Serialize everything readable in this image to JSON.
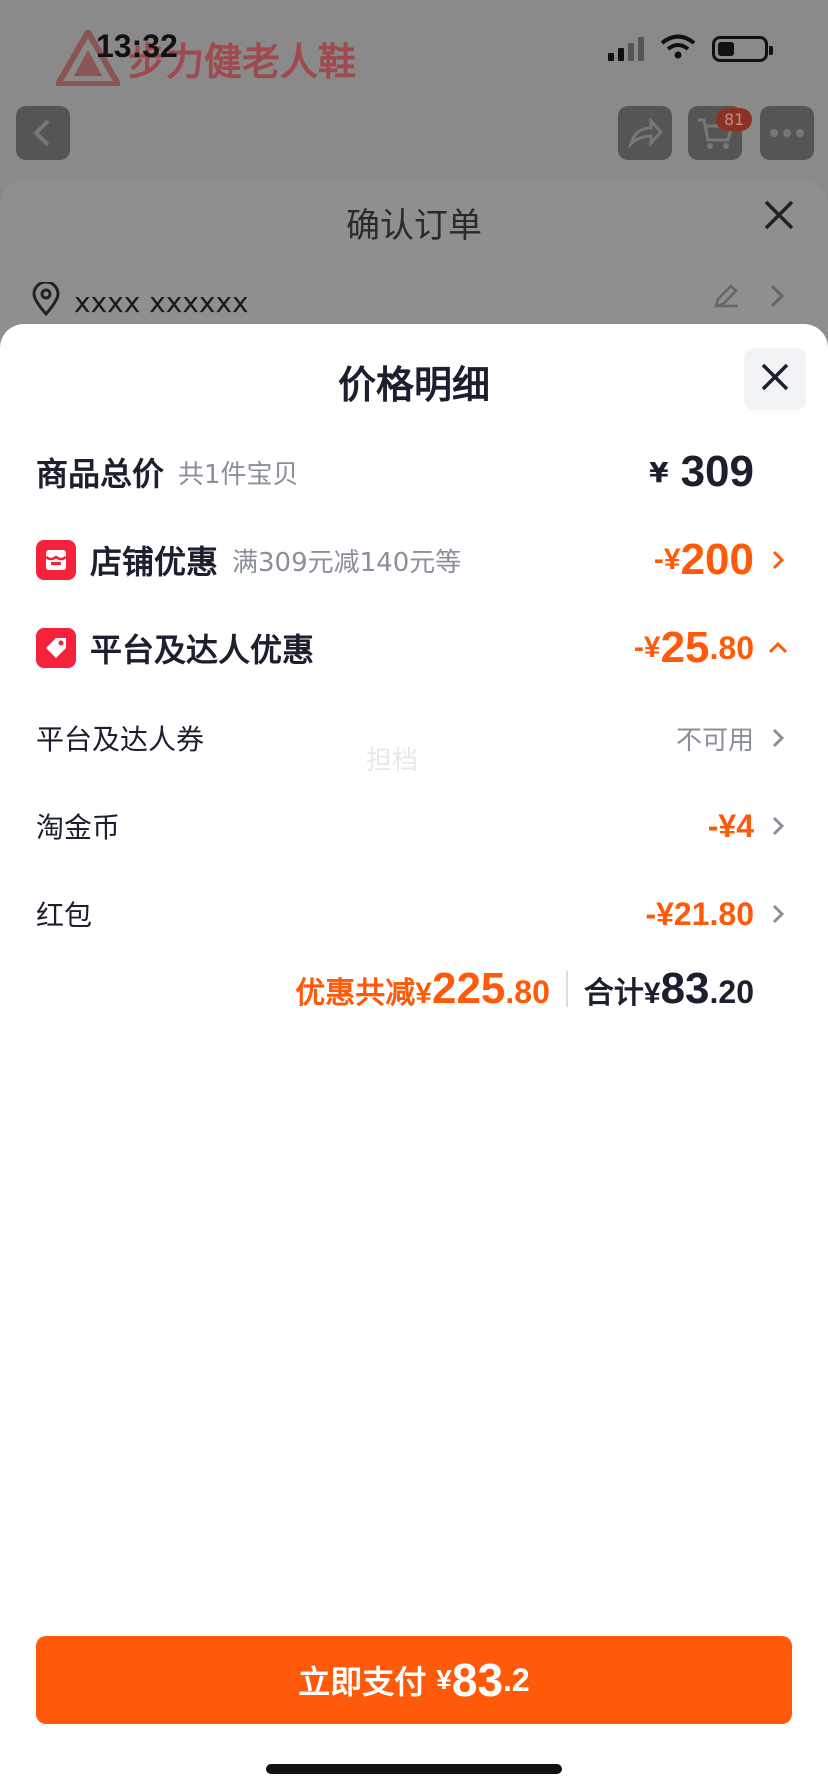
{
  "status_bar": {
    "time": "13:32"
  },
  "background": {
    "brand_text": "步力健老人鞋",
    "cart_count": "81",
    "order_title": "确认订单",
    "address": "xxxx xxxxxx"
  },
  "price_detail": {
    "title": "价格明细",
    "goods_total": {
      "label": "商品总价",
      "sub": "共1件宝贝",
      "currency": "¥",
      "amount": "309"
    },
    "shop_discount": {
      "label": "店铺优惠",
      "sub": "满309元减140元等",
      "prefix": "-¥",
      "amount": "200"
    },
    "platform_discount": {
      "label": "平台及达人优惠",
      "prefix": "-¥",
      "amount_int": "25",
      "amount_dec": ".80"
    },
    "coupon": {
      "label": "平台及达人券",
      "value": "不可用"
    },
    "taojinbi": {
      "label": "淘金币",
      "value": "-¥4"
    },
    "red_packet": {
      "label": "红包",
      "value": "-¥21.80"
    },
    "watermark": "担档",
    "summary": {
      "discount_label": "优惠共减¥",
      "discount_int": "225",
      "discount_dec": ".80",
      "total_label": "合计¥",
      "total_int": "83",
      "total_dec": ".20"
    },
    "pay_button": {
      "label": "立即支付",
      "currency": "¥",
      "amount_int": "83",
      "amount_dec": ".2"
    }
  },
  "colors": {
    "accent": "#ff5a0a",
    "badge_red": "#f5223c",
    "text_dark": "#1b1f2e",
    "text_gray": "#8a8f99"
  }
}
